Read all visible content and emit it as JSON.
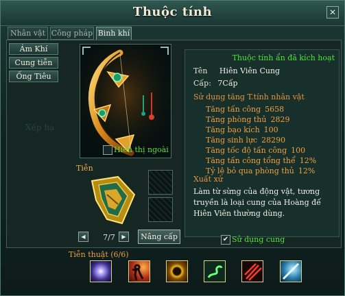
{
  "window": {
    "title": "Thuộc tính",
    "close_label": "✕"
  },
  "tabs": [
    {
      "label": "Nhân vật",
      "active": false
    },
    {
      "label": "Công pháp",
      "active": false
    },
    {
      "label": "Binh khí",
      "active": true
    }
  ],
  "subtabs": [
    "Ám Khí",
    "Cung tiễn",
    "Ống Tiêu"
  ],
  "background_text": {
    "ghost_label": "Xếp hạ"
  },
  "preview": {
    "show_outer_label": "Hiển thị ngoài",
    "show_outer_checked": false
  },
  "ammo": {
    "label": "Tiễn",
    "page": "7/7",
    "upgrade_button": "Nâng cấp"
  },
  "info": {
    "hidden_attr_notice": "Thuộc tính ẩn đã kích hoạt",
    "name_key": "Tên",
    "name_value": "Hiên Viên Cung",
    "level_key": "Cấp:",
    "level_value": "7Cấp",
    "usage_heading": "Sử dụng tăng T.tính nhân vật",
    "stats": [
      {
        "label": "Tăng tấn công",
        "value": "5658"
      },
      {
        "label": "Tăng phòng thủ",
        "value": "2829"
      },
      {
        "label": "Tăng bạo kích",
        "value": "100"
      },
      {
        "label": "Tăng sinh lực",
        "value": "28290"
      },
      {
        "label": "Tăng tốc độ tấn công",
        "value": "100"
      },
      {
        "label": "Tăng tấn công tổng thể",
        "value": "12%"
      },
      {
        "label": "Tỷ lệ bỏ qua phòng thủ",
        "value": "12%"
      }
    ],
    "origin_heading": "Xuất xứ",
    "origin_text": "Làm từ sừng của động vật, tương truyền là loại cung của Hoàng đế Hiên Viên thường dùng.",
    "use_bow_label": "Sử dụng cung",
    "use_bow_checked": true,
    "check_glyph": "✔"
  },
  "skills": {
    "title": "Tiễn thuật (6/6)",
    "icons": [
      "starburst-skill-icon",
      "fire-warrior-skill-icon",
      "golden-ring-skill-icon",
      "green-serpent-skill-icon",
      "red-arrows-skill-icon",
      "blue-lance-skill-icon"
    ]
  },
  "colors": {
    "highlight_green": "#52e33b",
    "stat_orange": "#f0a040",
    "title_cream": "#f2ecd6"
  }
}
